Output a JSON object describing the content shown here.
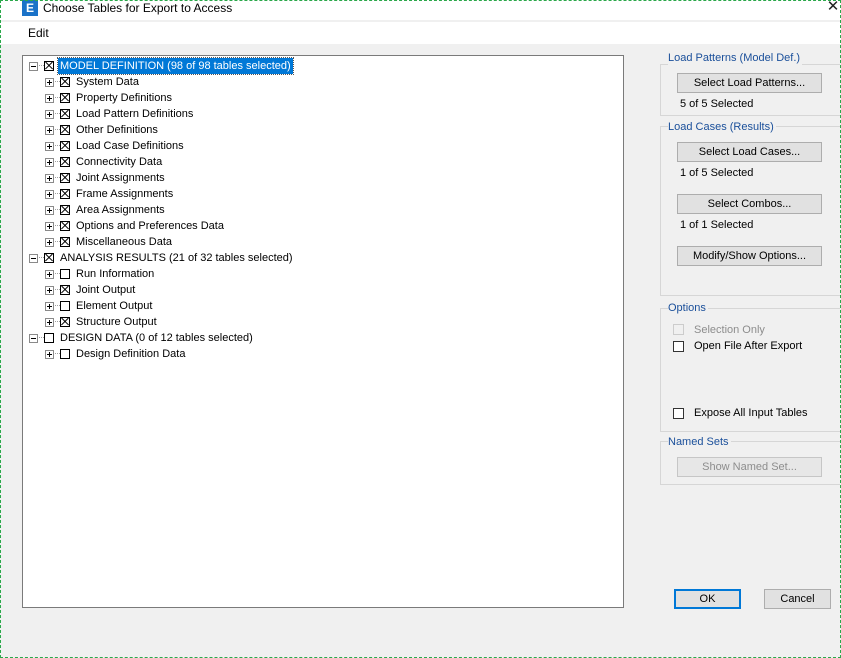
{
  "window": {
    "app_icon_letter": "E",
    "title": "Choose Tables for Export to Access"
  },
  "menu": {
    "edit": "Edit"
  },
  "tree": [
    {
      "label": "MODEL DEFINITION  (98 of 98 tables selected)",
      "checked": true,
      "level": 0,
      "expander": "minus",
      "selected": true
    },
    {
      "label": "System Data",
      "checked": true,
      "level": 1,
      "expander": "plus"
    },
    {
      "label": "Property Definitions",
      "checked": true,
      "level": 1,
      "expander": "plus"
    },
    {
      "label": "Load Pattern Definitions",
      "checked": true,
      "level": 1,
      "expander": "plus"
    },
    {
      "label": "Other Definitions",
      "checked": true,
      "level": 1,
      "expander": "plus"
    },
    {
      "label": "Load Case Definitions",
      "checked": true,
      "level": 1,
      "expander": "plus"
    },
    {
      "label": "Connectivity Data",
      "checked": true,
      "level": 1,
      "expander": "plus"
    },
    {
      "label": "Joint Assignments",
      "checked": true,
      "level": 1,
      "expander": "plus"
    },
    {
      "label": "Frame Assignments",
      "checked": true,
      "level": 1,
      "expander": "plus"
    },
    {
      "label": "Area Assignments",
      "checked": true,
      "level": 1,
      "expander": "plus"
    },
    {
      "label": "Options and Preferences Data",
      "checked": true,
      "level": 1,
      "expander": "plus"
    },
    {
      "label": "Miscellaneous Data",
      "checked": true,
      "level": 1,
      "expander": "plus"
    },
    {
      "label": "ANALYSIS RESULTS  (21 of 32 tables selected)",
      "checked": true,
      "level": 0,
      "expander": "minus"
    },
    {
      "label": "Run Information",
      "checked": false,
      "level": 1,
      "expander": "plus"
    },
    {
      "label": "Joint Output",
      "checked": true,
      "level": 1,
      "expander": "plus"
    },
    {
      "label": "Element Output",
      "checked": false,
      "level": 1,
      "expander": "plus"
    },
    {
      "label": "Structure Output",
      "checked": true,
      "level": 1,
      "expander": "plus"
    },
    {
      "label": "DESIGN DATA  (0 of 12 tables selected)",
      "checked": false,
      "level": 0,
      "expander": "minus"
    },
    {
      "label": "Design Definition Data",
      "checked": false,
      "level": 1,
      "expander": "plus"
    }
  ],
  "load_patterns": {
    "title": "Load Patterns (Model Def.)",
    "button": "Select Load Patterns...",
    "status": "5 of 5 Selected"
  },
  "load_cases": {
    "title": "Load Cases (Results)",
    "cases_button": "Select Load Cases...",
    "cases_status": "1 of 5 Selected",
    "combos_button": "Select Combos...",
    "combos_status": "1 of 1 Selected",
    "options_button": "Modify/Show Options..."
  },
  "options": {
    "title": "Options",
    "selection_only": {
      "label": "Selection Only",
      "checked": false,
      "disabled": true
    },
    "open_file": {
      "label": "Open File After Export",
      "checked": false,
      "disabled": false
    },
    "expose_all": {
      "label": "Expose All Input Tables",
      "checked": false,
      "disabled": false
    }
  },
  "named_sets": {
    "title": "Named Sets",
    "button": "Show Named Set...",
    "disabled": true
  },
  "footer": {
    "ok": "OK",
    "cancel": "Cancel"
  },
  "colors": {
    "accent": "#0078d7",
    "group_title": "#1a4f9a",
    "frame_dash": "#2aa84a"
  }
}
